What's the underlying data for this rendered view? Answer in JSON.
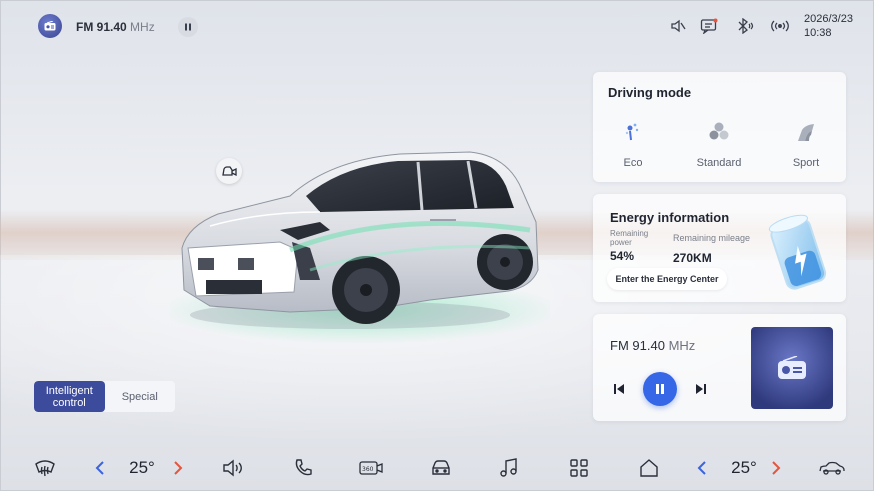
{
  "status_bar": {
    "radio_band": "FM",
    "radio_freq": "91.40",
    "radio_unit": "MHz",
    "date": "2026/3/23",
    "time": "10:38",
    "icons": [
      "radio-icon",
      "pause-icon",
      "mute-icon",
      "message-icon",
      "bluetooth-icon",
      "signal-icon"
    ]
  },
  "controls": {
    "segments": [
      "Intelligent control",
      "Special"
    ],
    "active_segment": "Intelligent control"
  },
  "driving_mode": {
    "title": "Driving mode",
    "modes": [
      "Eco",
      "Standard",
      "Sport"
    ],
    "selected": "Eco"
  },
  "energy": {
    "title": "Energy information",
    "power_label": "Remaining power",
    "power_value": "54%",
    "mileage_label": "Remaining mileage",
    "mileage_value": "270KM",
    "button_label": "Enter the Energy Center"
  },
  "media": {
    "band": "FM",
    "freq": "91.40",
    "unit": "MHz",
    "state": "playing"
  },
  "bottom_bar": {
    "left_temp": "25°",
    "right_temp": "25°",
    "icons": [
      "defrost-icon",
      "volume-icon",
      "phone-icon",
      "camera-360-icon",
      "car-icon",
      "music-icon",
      "apps-icon",
      "home-icon",
      "car-side-icon"
    ]
  },
  "colors": {
    "accent": "#3567e6",
    "segment_active": "#3d4b9c",
    "temp_down": "#3a63e0",
    "temp_up": "#e5553e"
  }
}
